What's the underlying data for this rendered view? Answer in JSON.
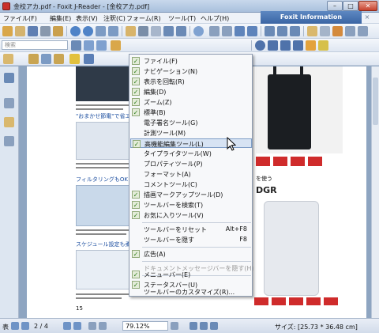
{
  "window": {
    "title": "金校アカ.pdf - Foxit J-Reader - [金校アカ.pdf]",
    "min_glyph": "–",
    "max_glyph": "□",
    "close_glyph": "✕"
  },
  "menubar": {
    "items": [
      "ファイル(F)",
      "編集(E)",
      "表示(V)",
      "注釈(C)",
      "フォーム(R)",
      "ツール(T)",
      "ヘルプ(H)"
    ],
    "info_panel": "Foxit Information",
    "info_close": "×"
  },
  "toolbar": {
    "search_placeholder": "検索"
  },
  "context_menu": {
    "items": [
      {
        "label": "ファイル(F)",
        "checked": true
      },
      {
        "label": "ナビゲーション(N)",
        "checked": true
      },
      {
        "label": "表示を回転(R)",
        "checked": true
      },
      {
        "label": "編集(D)",
        "checked": true
      },
      {
        "label": "ズーム(Z)",
        "checked": true
      },
      {
        "label": "標準(B)",
        "checked": true
      },
      {
        "label": "電子署名ツール(G)",
        "checked": false
      },
      {
        "label": "計測ツール(M)",
        "checked": false
      },
      {
        "label": "高機能編集ツール(L)",
        "checked": true,
        "highlighted": true
      },
      {
        "label": "タイプライタツール(W)",
        "checked": false
      },
      {
        "label": "プロパティツール(P)",
        "checked": false
      },
      {
        "label": "フォーマット(A)",
        "checked": false
      },
      {
        "label": "コメントツール(C)",
        "checked": false
      },
      {
        "label": "描画マークアップツール(D)",
        "checked": true
      },
      {
        "label": "ツールバーを検索(T)",
        "checked": true
      },
      {
        "label": "お気に入りツール(V)",
        "checked": true
      },
      {
        "label": "ツールバーをリセット",
        "shortcut": "Alt+F8"
      },
      {
        "label": "ツールバーを隠す",
        "shortcut": "F8"
      },
      {
        "label": "広告(A)",
        "checked": true
      },
      {
        "label": "ドキュメントメッセージバーを隠す(H)",
        "disabled": true
      },
      {
        "label": "メニューバー(E)",
        "checked": true
      },
      {
        "label": "ステータスバー(U)",
        "checked": true
      },
      {
        "label": "ツールバーのカスタマイズ(R)..."
      }
    ],
    "check_glyph": "✓"
  },
  "page": {
    "texts": {
      "t1": "\"おまかせ節電\"で省エネ",
      "t2": "フィルタリングもOK",
      "t3": "スケジュール設定も柔軟",
      "t4": "を使う",
      "t5": "DGR",
      "t6": "15"
    }
  },
  "statusbar": {
    "page_label": "表",
    "page_value": "2 / 4",
    "zoom_value": "79.12%",
    "size_text": "サイズ: [25.73 * 36.48 cm]"
  },
  "colors": {
    "accent": "#3a65a3",
    "menu_highlight": "#d7e3f3",
    "check_green": "#2f7d1c"
  }
}
